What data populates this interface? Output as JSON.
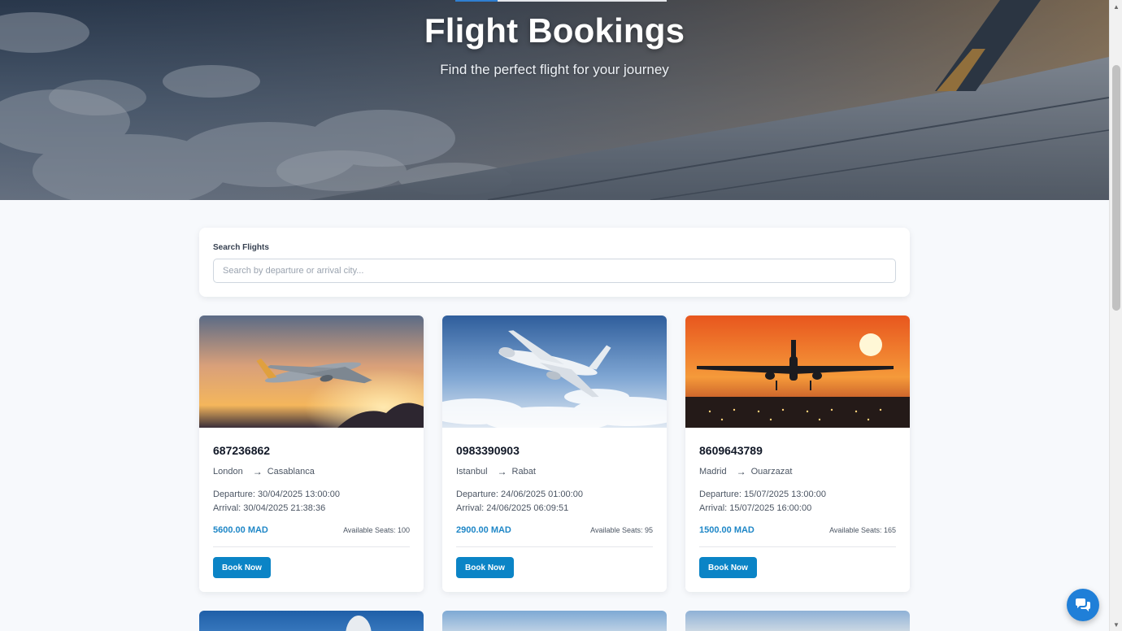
{
  "hero": {
    "title": "Flight Bookings",
    "subtitle": "Find the perfect flight for your journey"
  },
  "search": {
    "label": "Search Flights",
    "placeholder": "Search by departure or arrival city...",
    "value": ""
  },
  "flights": [
    {
      "number": "687236862",
      "from": "London",
      "to": "Casablanca",
      "departure": "Departure: 30/04/2025 13:00:00",
      "arrival": "Arrival: 30/04/2025 21:38:36",
      "price": "5600.00 MAD",
      "seats": "Available Seats: 100",
      "book_label": "Book Now"
    },
    {
      "number": "0983390903",
      "from": "Istanbul",
      "to": "Rabat",
      "departure": "Departure: 24/06/2025 01:00:00",
      "arrival": "Arrival: 24/06/2025 06:09:51",
      "price": "2900.00 MAD",
      "seats": "Available Seats: 95",
      "book_label": "Book Now"
    },
    {
      "number": "8609643789",
      "from": "Madrid",
      "to": "Ouarzazat",
      "departure": "Departure: 15/07/2025 13:00:00",
      "arrival": "Arrival: 15/07/2025 16:00:00",
      "price": "1500.00 MAD",
      "seats": "Available Seats: 165",
      "book_label": "Book Now"
    }
  ],
  "icons": {
    "route_arrow": "→",
    "chat": "chat-bubbles-icon"
  },
  "colors": {
    "accent": "#0b84c6",
    "price": "#1f87c7",
    "chat_fab": "#1f7fd8"
  }
}
